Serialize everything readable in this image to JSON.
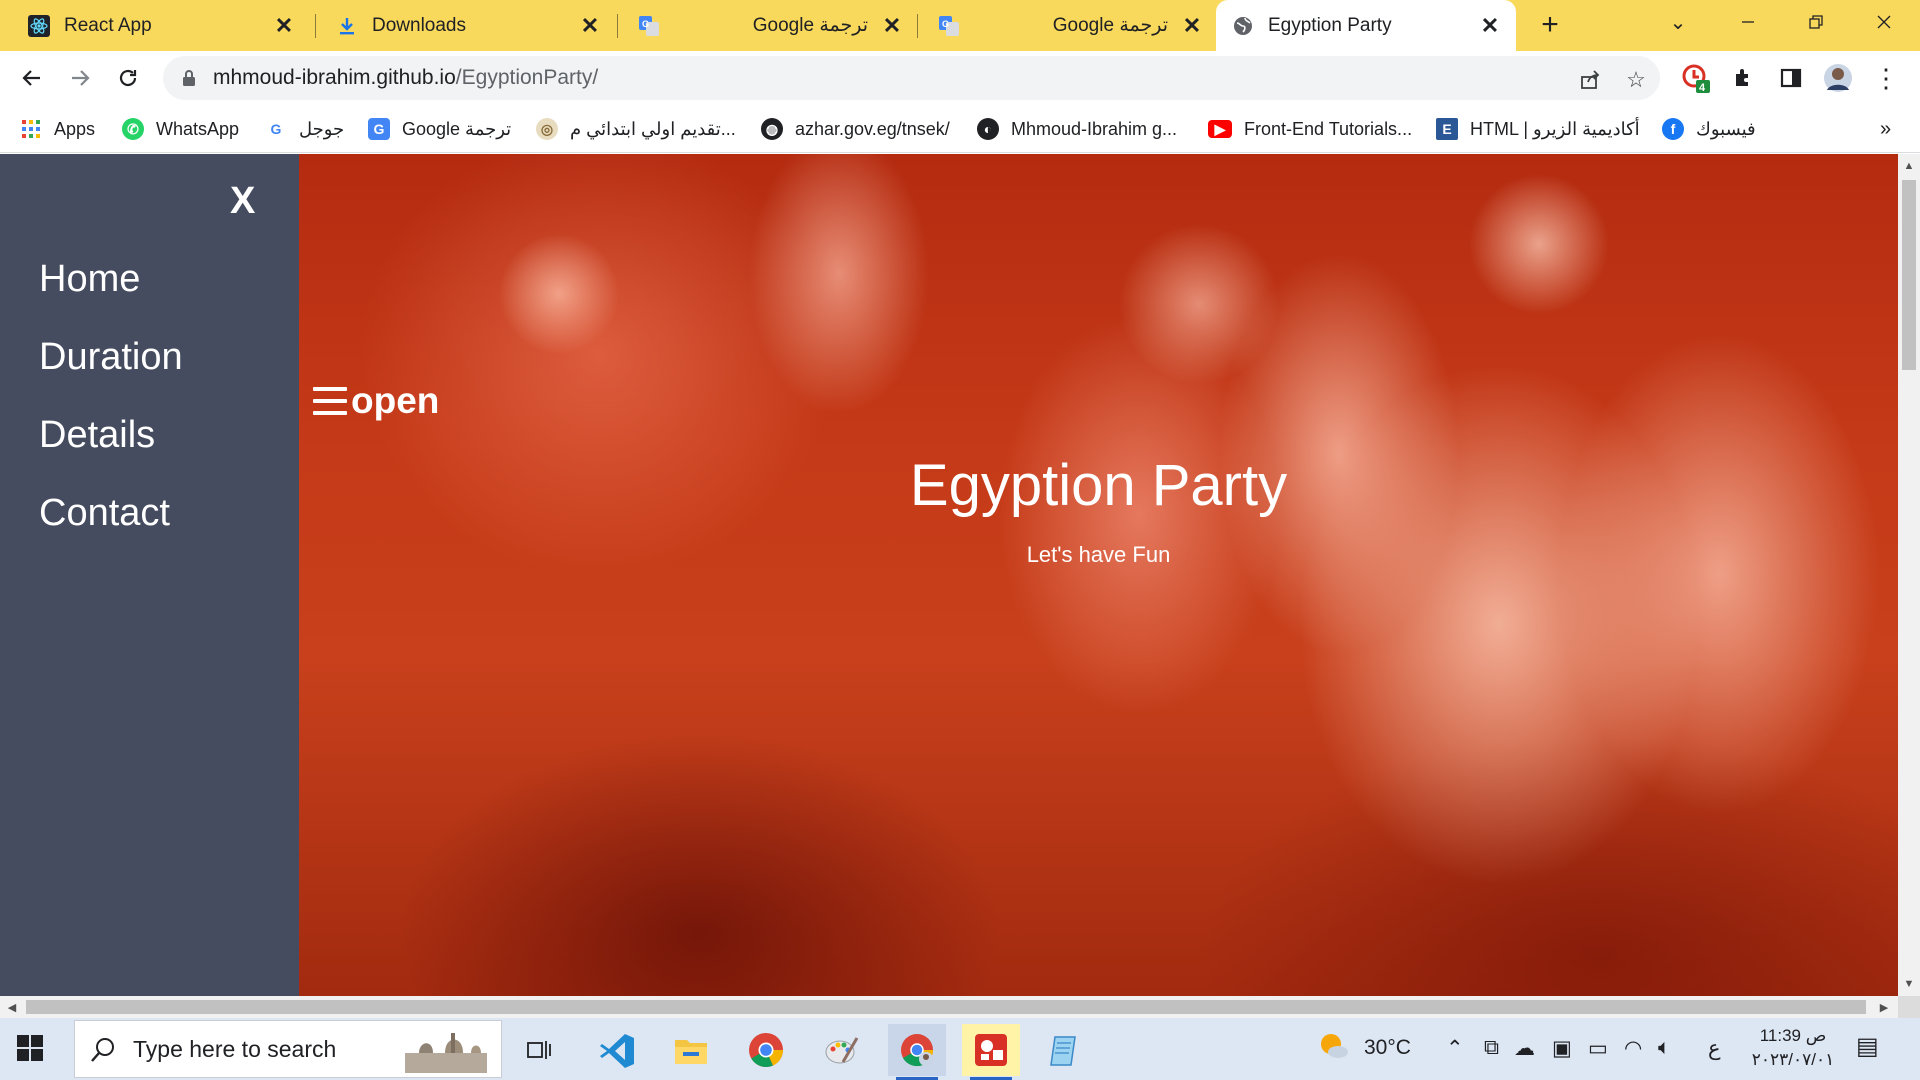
{
  "browser": {
    "tabs": [
      {
        "title": "React App",
        "icon": "react-icon",
        "active": false
      },
      {
        "title": "Downloads",
        "icon": "download-icon",
        "active": false
      },
      {
        "title": "Google ترجمة",
        "icon": "google-translate-icon",
        "active": false
      },
      {
        "title": "Google ترجمة",
        "icon": "google-translate-icon",
        "active": false
      },
      {
        "title": "Egyption Party",
        "icon": "globe-icon",
        "active": true
      }
    ],
    "new_tab_label": "+",
    "address": {
      "host": "mhmoud-ibrahim.github.io",
      "path": "/EgyptionParty/"
    },
    "extension_badge": "4",
    "bookmarks": [
      {
        "label": "Apps",
        "icon": "apps-grid-icon"
      },
      {
        "label": "WhatsApp",
        "icon": "whatsapp-icon"
      },
      {
        "label": "جوجل",
        "icon": "google-icon"
      },
      {
        "label": "Google ترجمة",
        "icon": "google-translate-icon"
      },
      {
        "label": "تقديم اولي ابتدائي م...",
        "icon": "seal-icon"
      },
      {
        "label": "azhar.gov.eg/tnsek/",
        "icon": "globe-icon"
      },
      {
        "label": "Mhmoud-Ibrahim g...",
        "icon": "github-icon"
      },
      {
        "label": "Front-End Tutorials...",
        "icon": "youtube-icon"
      },
      {
        "label": "HTML | أكاديمية الزيرو",
        "icon": "e-icon"
      },
      {
        "label": "فيسبوك",
        "icon": "facebook-icon"
      }
    ],
    "more_bookmarks": "»"
  },
  "page": {
    "sidebar": {
      "close_label": "X",
      "items": [
        "Home",
        "Duration",
        "Details",
        "Contact"
      ]
    },
    "open_button": {
      "label": "open",
      "icon": "hamburger-icon"
    },
    "hero": {
      "title": "Egyption Party",
      "subtitle": "Let's have Fun"
    }
  },
  "taskbar": {
    "search_placeholder": "Type here to search",
    "apps": [
      "task-view-icon",
      "vscode-icon",
      "file-explorer-icon",
      "chrome-icon",
      "paint-icon",
      "chrome-profile-icon",
      "photo-app-icon",
      "notepad-icon"
    ],
    "weather": "30°C",
    "language": "ع",
    "time": "11:39 ص",
    "date": "٢٠٢٣/٠٧/٠١"
  },
  "colors": {
    "tab_strip": "#f9d95c",
    "sidebar": "#454c5f",
    "hero_tint": "#c53a18",
    "taskbar": "#dde6f3"
  }
}
